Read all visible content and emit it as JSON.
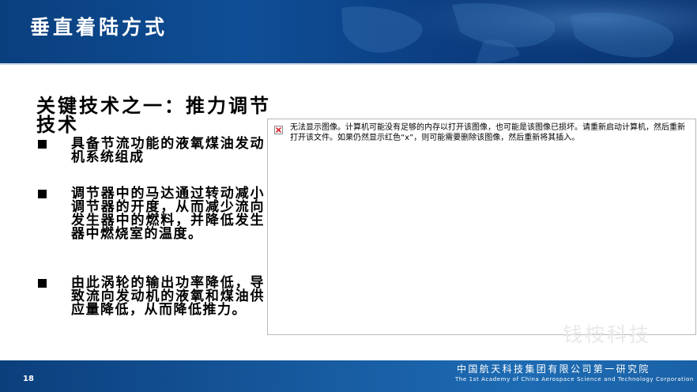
{
  "header": {
    "title": "垂直着陆方式"
  },
  "content": {
    "heading": "关键技术之一：推力调节技术",
    "bullets": [
      {
        "text": "具备节流功能的液氧煤油发动机系统组成"
      },
      {
        "text": "调节器中的马达通过转动减小调节器的开度，从而减少流向发生器中的燃料，并降低发生器中燃烧室的温度。"
      },
      {
        "text": "由此涡轮的输出功率降低，导致流向发动机的液氧和煤油供应量降低，从而降低推力。"
      }
    ],
    "stray_mark": ","
  },
  "broken_image": {
    "icon": "broken-image-icon",
    "message": "无法显示图像。计算机可能没有足够的内存以打开该图像，也可能是该图像已损坏。请重新启动计算机，然后重新打开该文件。如果仍然显示红色“x”，则可能需要删除该图像，然后重新将其插入。"
  },
  "watermark": "钱桉科技",
  "footer": {
    "page_number": "18",
    "org_cn": "中国航天科技集团有限公司第一研究院",
    "org_en": "The 1st Academy of China Aerospace Science and Technology Corporation"
  },
  "colors": {
    "header_bg": "#0f4e96",
    "footer_bg": "#175a9f",
    "error_x": "#d9252c"
  }
}
